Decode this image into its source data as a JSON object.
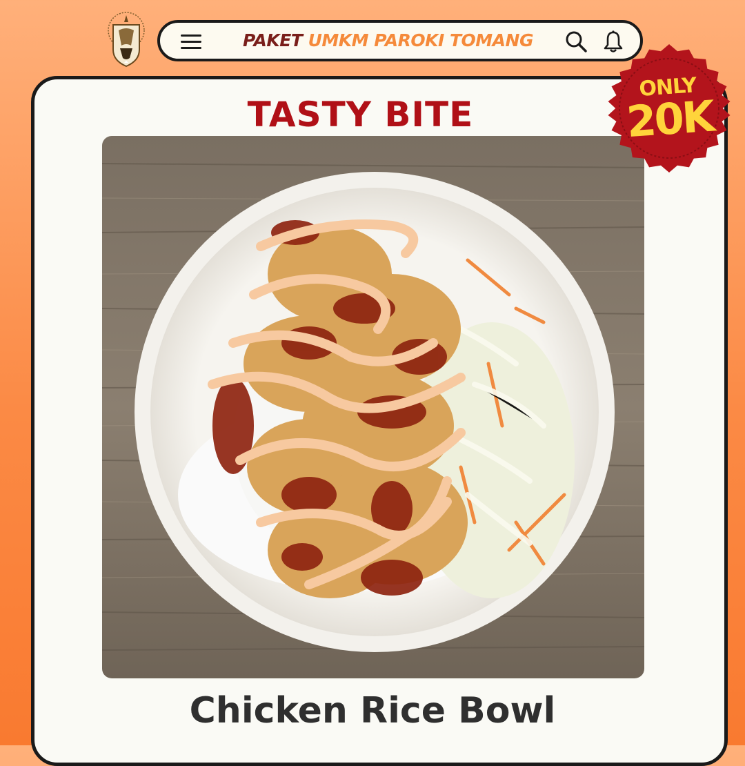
{
  "header": {
    "title_part1": "PAKET",
    "title_part2": "UMKM PAROKI TOMANG",
    "menu_icon": "hamburger-menu-icon",
    "search_icon": "search-icon",
    "notification_icon": "bell-icon"
  },
  "card": {
    "headline": "TASTY BITE",
    "product_name": "Chicken Rice Bowl",
    "photo": "chicken-rice-bowl-photo"
  },
  "badge": {
    "line1": "ONLY",
    "line2": "20K"
  },
  "colors": {
    "background_top": "#ffb07a",
    "background_bottom": "#f97a30",
    "headline": "#b01017",
    "badge": "#b3141c",
    "badge_text": "#ffd43b",
    "title_dark": "#7a1f1a",
    "title_accent": "#f58a3a"
  }
}
